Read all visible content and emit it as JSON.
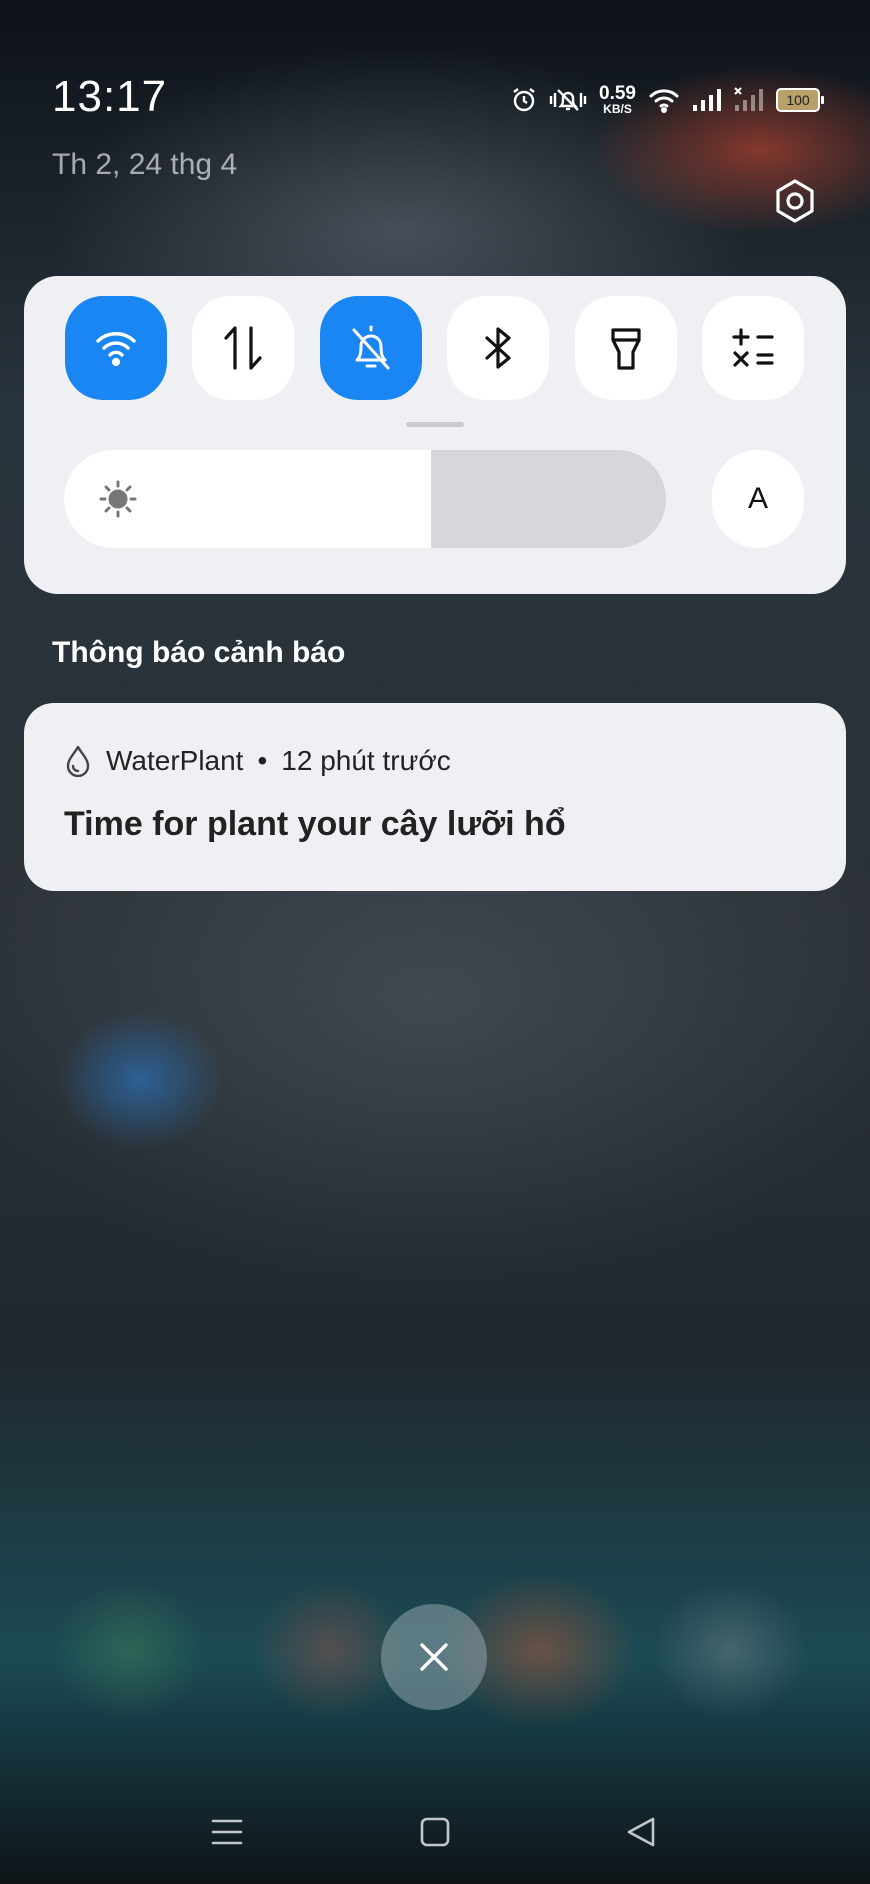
{
  "status_bar": {
    "time": "13:17",
    "date": "Th 2, 24 thg 4",
    "net_speed_value": "0.59",
    "net_speed_unit": "KB/S",
    "battery": "100",
    "icons": [
      "alarm-icon",
      "vibrate-off-icon",
      "wifi-icon",
      "signal-icon",
      "no-signal-icon",
      "battery-icon"
    ]
  },
  "quick_settings": {
    "tiles": [
      {
        "name": "wifi",
        "icon": "wifi-icon",
        "active": true
      },
      {
        "name": "mobile-data",
        "icon": "data-arrows-icon",
        "active": false
      },
      {
        "name": "silent-mode",
        "icon": "bell-off-icon",
        "active": true
      },
      {
        "name": "bluetooth",
        "icon": "bluetooth-icon",
        "active": false
      },
      {
        "name": "flashlight",
        "icon": "flashlight-icon",
        "active": false
      },
      {
        "name": "calculator",
        "icon": "calculator-icon",
        "active": false
      }
    ],
    "brightness_level": 0.61,
    "auto_brightness_label": "A",
    "accent_color": "#1a86f3"
  },
  "notifications": {
    "section_title": "Thông báo cảnh báo",
    "items": [
      {
        "app_name": "WaterPlant",
        "separator": "•",
        "time_ago": "12 phút trước",
        "title": "Time for plant your cây lưỡi hổ",
        "icon": "water-drop-icon"
      }
    ]
  },
  "nav_bar": {
    "buttons": [
      "menu-icon",
      "home-icon",
      "back-icon"
    ]
  }
}
